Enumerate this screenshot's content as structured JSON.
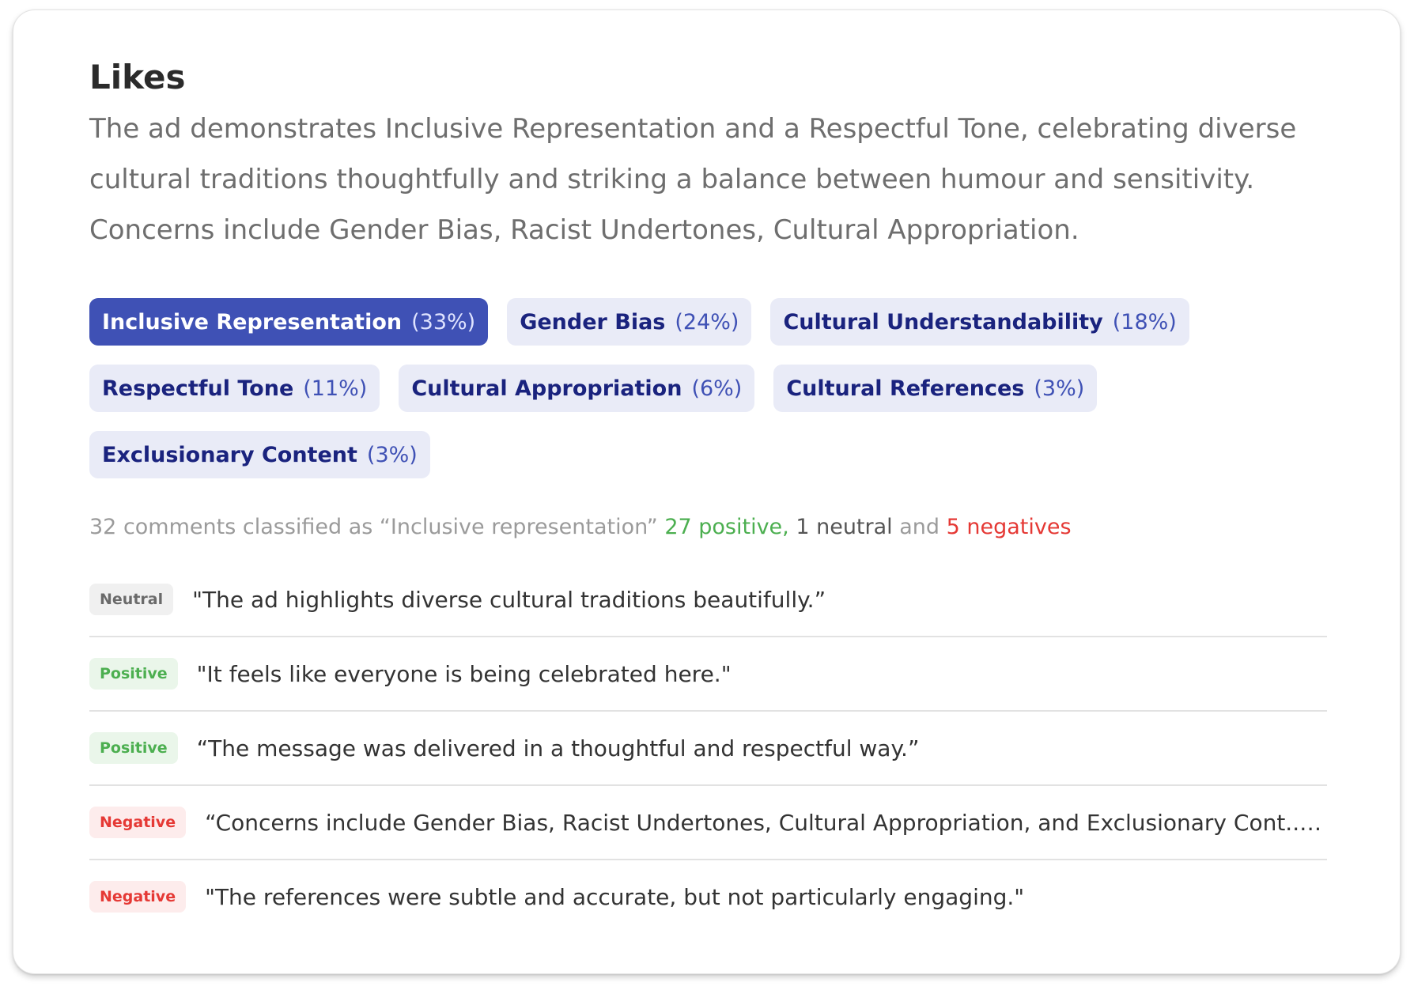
{
  "card": {
    "title": "Likes",
    "summary": "The ad demonstrates Inclusive Representation and a Respectful Tone, celebrating diverse cultural traditions thoughtfully and striking a balance between humour and sensitivity. Concerns include Gender Bias, Racist Undertones, Cultural Appropriation."
  },
  "chips": [
    {
      "label": "Inclusive Representation",
      "pct": "(33%)",
      "active": true
    },
    {
      "label": "Gender Bias",
      "pct": "(24%)",
      "active": false
    },
    {
      "label": "Cultural Understandability",
      "pct": "(18%)",
      "active": false
    },
    {
      "label": "Respectful Tone",
      "pct": "(11%)",
      "active": false
    },
    {
      "label": "Cultural Appropriation",
      "pct": "(6%)",
      "active": false
    },
    {
      "label": "Cultural References",
      "pct": "(3%)",
      "active": false
    },
    {
      "label": "Exclusionary Content",
      "pct": "(3%)",
      "active": false
    }
  ],
  "stats": {
    "prefix": "32 comments classified as “Inclusive representation” ",
    "positive": "27 positive,",
    "neutral": " 1 neutral",
    "and": " and ",
    "negative": "5 negatives"
  },
  "comments": [
    {
      "sentiment": "Neutral",
      "text": "\"The ad highlights diverse cultural traditions beautifully.”"
    },
    {
      "sentiment": "Positive",
      "text": "\"It feels like everyone is being celebrated here.\""
    },
    {
      "sentiment": "Positive",
      "text": "“The message was delivered in a thoughtful and respectful way.”"
    },
    {
      "sentiment": "Negative",
      "text": "“Concerns include Gender Bias, Racist Undertones, Cultural Appropriation, and Exclusionary Cont...”t, highli..."
    },
    {
      "sentiment": "Negative",
      "text": "\"The references were subtle and accurate, but not particularly engaging.\""
    }
  ],
  "colors": {
    "accent": "#3f51b5",
    "chip_bg": "#e9ebf7",
    "positive": "#4caf50",
    "negative": "#e53935",
    "neutral": "#6a6a6a"
  }
}
